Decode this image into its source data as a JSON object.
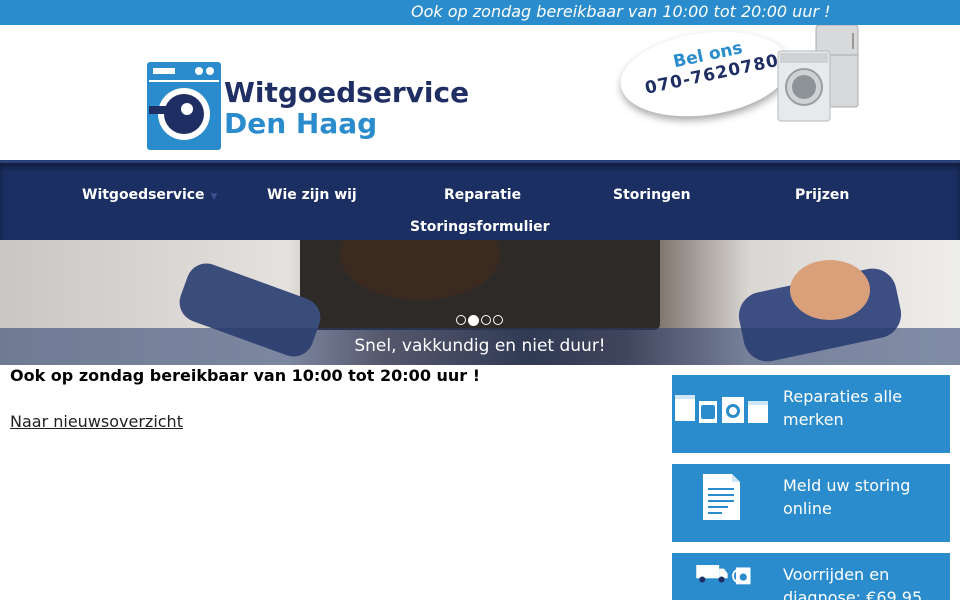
{
  "topbar": {
    "text": "Ook op zondag bereikbaar van 10:00 tot 20:00 uur !"
  },
  "logo": {
    "line1": "Witgoedservice",
    "line2": "Den Haag"
  },
  "callout": {
    "label": "Bel ons",
    "phone": "070-7620780"
  },
  "nav": {
    "items": [
      {
        "label": "Witgoedservice",
        "has_dropdown": true
      },
      {
        "label": "Wie zijn wij"
      },
      {
        "label": "Reparatie"
      },
      {
        "label": "Storingen"
      },
      {
        "label": "Prijzen"
      },
      {
        "label": "Storingsformulier"
      }
    ]
  },
  "hero": {
    "caption": "Snel, vakkundig en niet duur!",
    "slides": 4,
    "active_slide": 2
  },
  "main": {
    "heading": "Ook op zondag bereikbaar van 10:00 tot 20:00 uur !",
    "back_link": "Naar nieuwsoverzicht"
  },
  "sidebar": {
    "boxes": [
      {
        "icon": "appliances-icon",
        "label": "Reparaties alle merken"
      },
      {
        "icon": "form-document-icon",
        "label": "Meld uw storing online"
      },
      {
        "icon": "van-diagnose-icon",
        "label": "Voorrijden en diagnose: €69,95"
      }
    ]
  },
  "colors": {
    "accent": "#2a8ccd",
    "navy": "#1b2f63",
    "white": "#ffffff"
  }
}
